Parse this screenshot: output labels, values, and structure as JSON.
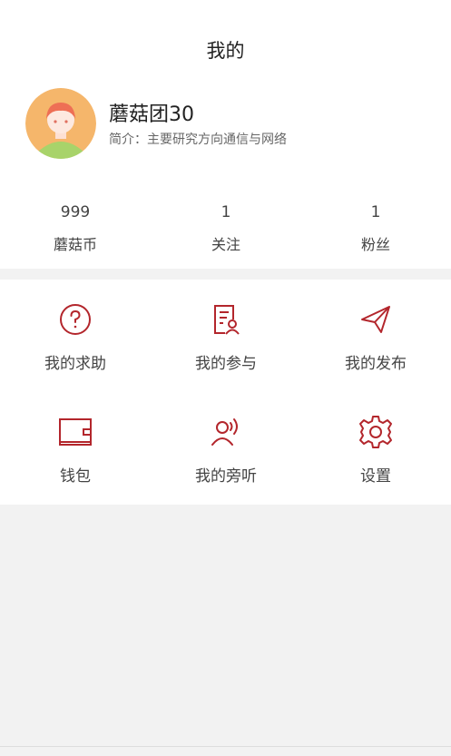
{
  "header": {
    "title": "我的"
  },
  "profile": {
    "name": "蘑菇团30",
    "bio": "简介：主要研究方向通信与网络"
  },
  "stats": [
    {
      "value": "999",
      "label": "蘑菇币"
    },
    {
      "value": "1",
      "label": "关注"
    },
    {
      "value": "1",
      "label": "粉丝"
    }
  ],
  "menu": [
    {
      "label": "我的求助",
      "icon": "question-circle-icon"
    },
    {
      "label": "我的参与",
      "icon": "document-person-icon"
    },
    {
      "label": "我的发布",
      "icon": "paper-plane-icon"
    },
    {
      "label": "钱包",
      "icon": "wallet-icon"
    },
    {
      "label": "我的旁听",
      "icon": "listening-person-icon"
    },
    {
      "label": "设置",
      "icon": "gear-icon"
    }
  ],
  "colors": {
    "accent": "#b3262c",
    "background": "#f2f2f2"
  }
}
